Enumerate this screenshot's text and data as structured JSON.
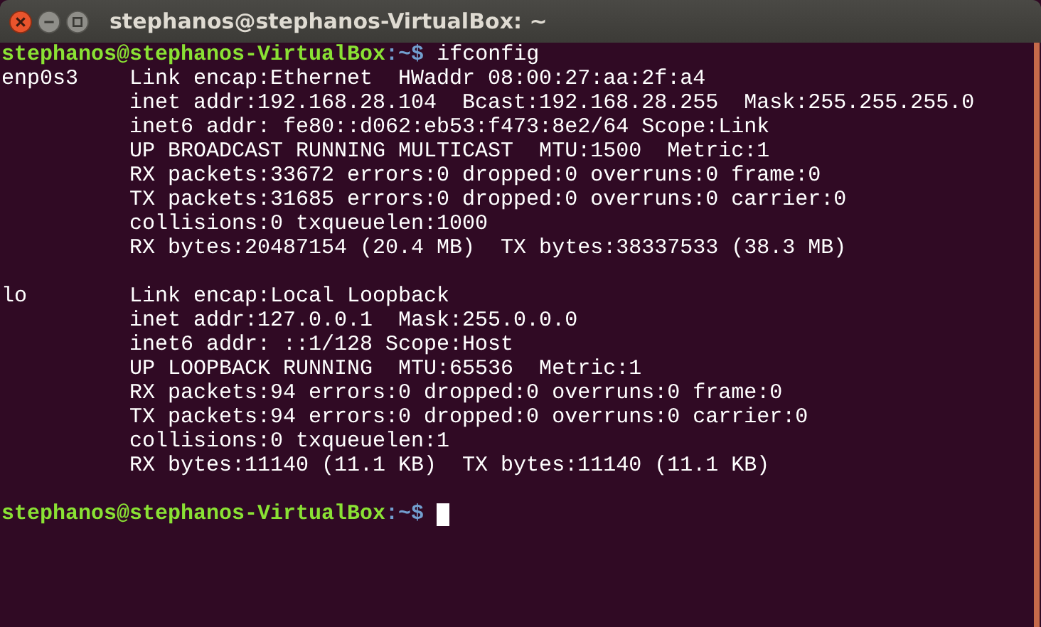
{
  "window": {
    "title": "stephanos@stephanos-VirtualBox: ~"
  },
  "lines": [
    {
      "kind": "prompt",
      "user_host": "stephanos@stephanos-VirtualBox",
      "path": ":~$",
      "command": "ifconfig"
    },
    {
      "kind": "output",
      "text": "enp0s3    Link encap:Ethernet  HWaddr 08:00:27:aa:2f:a4"
    },
    {
      "kind": "output",
      "text": "          inet addr:192.168.28.104  Bcast:192.168.28.255  Mask:255.255.255.0"
    },
    {
      "kind": "output",
      "text": "          inet6 addr: fe80::d062:eb53:f473:8e2/64 Scope:Link"
    },
    {
      "kind": "output",
      "text": "          UP BROADCAST RUNNING MULTICAST  MTU:1500  Metric:1"
    },
    {
      "kind": "output",
      "text": "          RX packets:33672 errors:0 dropped:0 overruns:0 frame:0"
    },
    {
      "kind": "output",
      "text": "          TX packets:31685 errors:0 dropped:0 overruns:0 carrier:0"
    },
    {
      "kind": "output",
      "text": "          collisions:0 txqueuelen:1000"
    },
    {
      "kind": "output",
      "text": "          RX bytes:20487154 (20.4 MB)  TX bytes:38337533 (38.3 MB)"
    },
    {
      "kind": "blank"
    },
    {
      "kind": "output",
      "text": "lo        Link encap:Local Loopback"
    },
    {
      "kind": "output",
      "text": "          inet addr:127.0.0.1  Mask:255.0.0.0"
    },
    {
      "kind": "output",
      "text": "          inet6 addr: ::1/128 Scope:Host"
    },
    {
      "kind": "output",
      "text": "          UP LOOPBACK RUNNING  MTU:65536  Metric:1"
    },
    {
      "kind": "output",
      "text": "          RX packets:94 errors:0 dropped:0 overruns:0 frame:0"
    },
    {
      "kind": "output",
      "text": "          TX packets:94 errors:0 dropped:0 overruns:0 carrier:0"
    },
    {
      "kind": "output",
      "text": "          collisions:0 txqueuelen:1"
    },
    {
      "kind": "output",
      "text": "          RX bytes:11140 (11.1 KB)  TX bytes:11140 (11.1 KB)"
    },
    {
      "kind": "blank"
    },
    {
      "kind": "prompt",
      "user_host": "stephanos@stephanos-VirtualBox",
      "path": ":~$",
      "cursor": true
    }
  ]
}
